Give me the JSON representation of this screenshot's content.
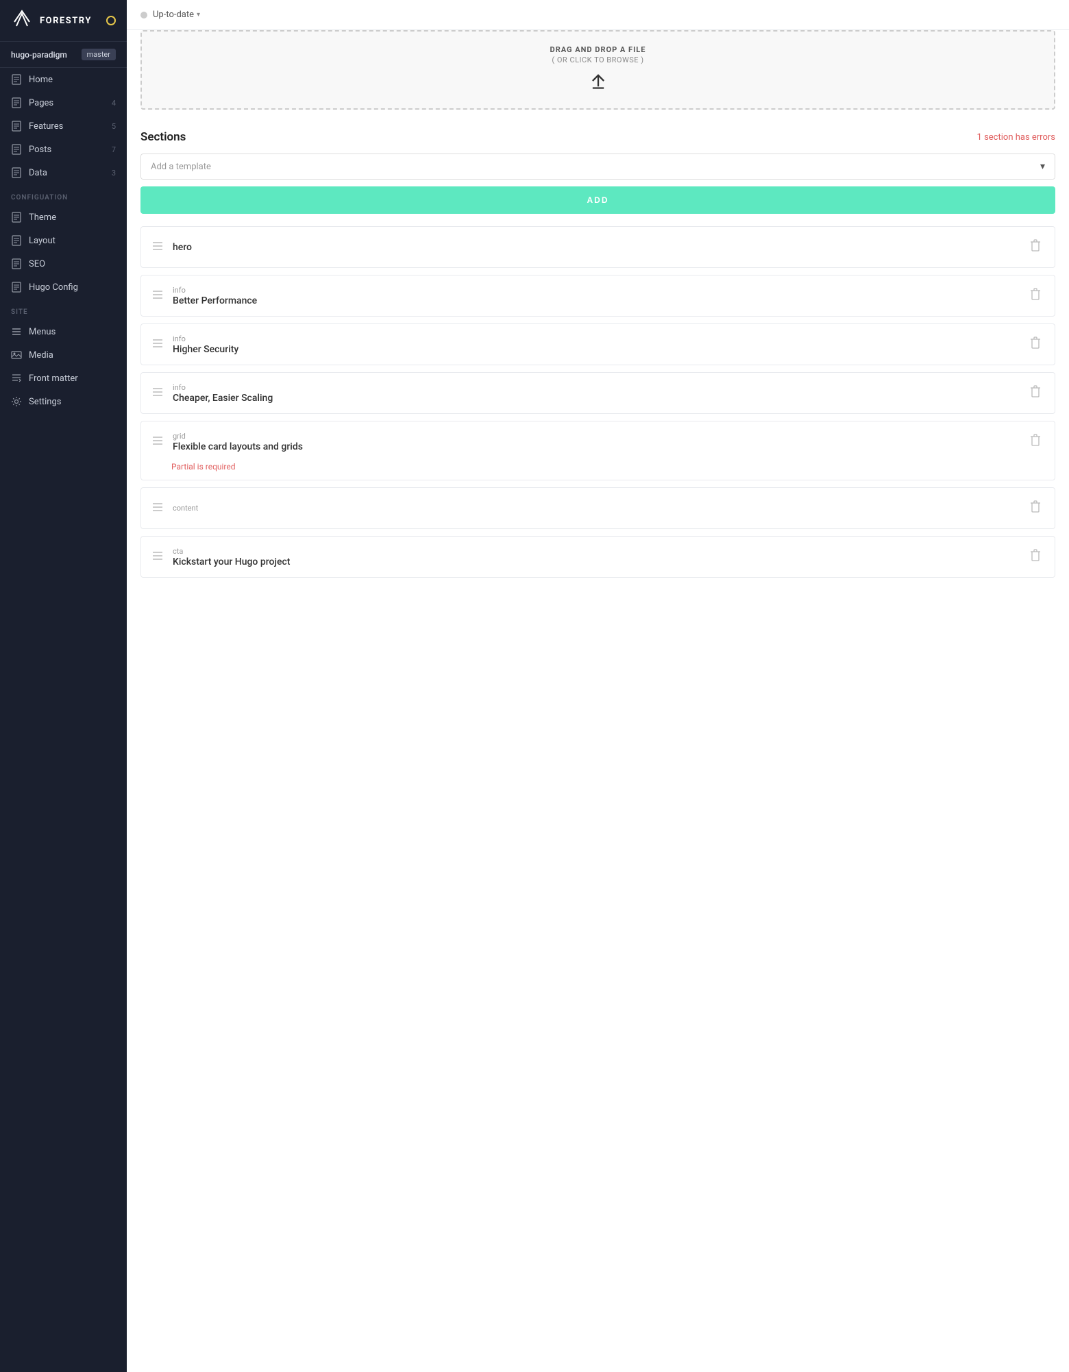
{
  "sidebar": {
    "logo_text": "FORESTRY",
    "repo_name": "hugo-paradigm",
    "branch": "master",
    "nav_items": [
      {
        "id": "home",
        "label": "Home",
        "icon": "document",
        "count": null
      },
      {
        "id": "pages",
        "label": "Pages",
        "icon": "document",
        "count": "4"
      },
      {
        "id": "features",
        "label": "Features",
        "icon": "document",
        "count": "5"
      },
      {
        "id": "posts",
        "label": "Posts",
        "icon": "document",
        "count": "7"
      },
      {
        "id": "data",
        "label": "Data",
        "icon": "document",
        "count": "3"
      }
    ],
    "config_label": "CONFIGUATION",
    "config_items": [
      {
        "id": "theme",
        "label": "Theme",
        "icon": "document",
        "count": null
      },
      {
        "id": "layout",
        "label": "Layout",
        "icon": "document",
        "count": null
      },
      {
        "id": "seo",
        "label": "SEO",
        "icon": "document",
        "count": null
      },
      {
        "id": "hugo-config",
        "label": "Hugo Config",
        "icon": "document",
        "count": null
      }
    ],
    "site_label": "SITE",
    "site_items": [
      {
        "id": "menus",
        "label": "Menus",
        "icon": "menu"
      },
      {
        "id": "media",
        "label": "Media",
        "icon": "media"
      },
      {
        "id": "front-matter",
        "label": "Front matter",
        "icon": "frontmatter"
      },
      {
        "id": "settings",
        "label": "Settings",
        "icon": "settings"
      }
    ]
  },
  "topbar": {
    "status_label": "Up-to-date",
    "chevron": "▾"
  },
  "upload": {
    "drag_text": "DRAG AND DROP A FILE",
    "browse_text": "( OR CLICK TO BROWSE )"
  },
  "sections": {
    "title": "Sections",
    "error_text": "1 section has errors",
    "add_template_placeholder": "Add a template",
    "add_button_label": "ADD",
    "items": [
      {
        "id": "hero",
        "type": "",
        "name": "hero",
        "has_error": false,
        "error_text": ""
      },
      {
        "id": "info-performance",
        "type": "info",
        "name": "Better Performance",
        "has_error": false,
        "error_text": ""
      },
      {
        "id": "info-security",
        "type": "info",
        "name": "Higher Security",
        "has_error": false,
        "error_text": ""
      },
      {
        "id": "info-scaling",
        "type": "info",
        "name": "Cheaper, Easier Scaling",
        "has_error": false,
        "error_text": ""
      },
      {
        "id": "grid-layouts",
        "type": "grid",
        "name": "Flexible card layouts and grids",
        "has_error": true,
        "error_text": "Partial is required"
      },
      {
        "id": "content",
        "type": "content",
        "name": "",
        "has_error": false,
        "error_text": ""
      },
      {
        "id": "cta",
        "type": "cta",
        "name": "Kickstart your Hugo project",
        "has_error": false,
        "error_text": ""
      }
    ]
  },
  "colors": {
    "accent": "#5de8c0",
    "error": "#e05c5c",
    "sidebar_bg": "#1a1f2e"
  }
}
